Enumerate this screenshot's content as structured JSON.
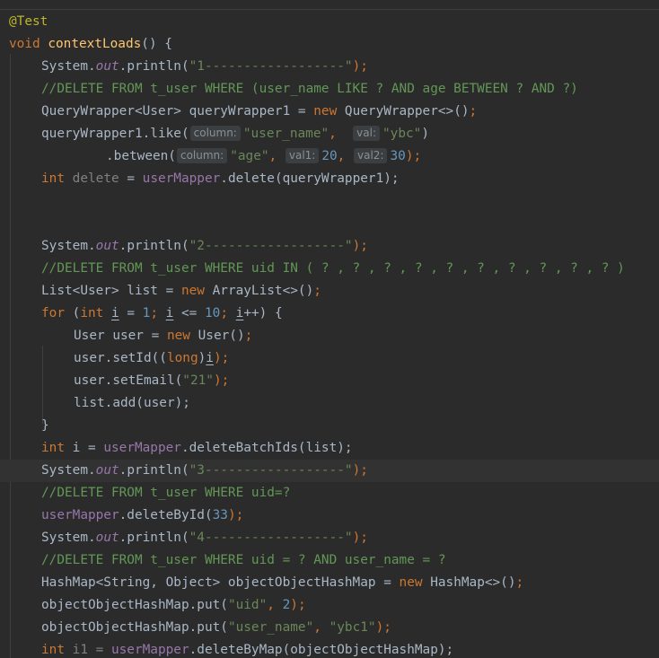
{
  "editor": {
    "annotation": "@Test",
    "method_decl": {
      "kw": "void",
      "name": "contextLoads",
      "rest": "() {"
    },
    "block1": {
      "print_prefix": "System.",
      "out": "out",
      "print_call": ".println(",
      "print_str": "\"1------------------\"",
      "print_end": ");",
      "comment": "//DELETE FROM t_user WHERE (user_name LIKE ? AND age BETWEEN ? AND ?)",
      "qw_type": "QueryWrapper<User> queryWrapper1 = ",
      "new_kw": "new",
      "qw_ctor": " QueryWrapper<>()",
      "semi": ";",
      "like_call": "queryWrapper1.like(",
      "hint_column": "column:",
      "like_arg1": "\"user_name\"",
      "comma": ",",
      "hint_val": "val:",
      "like_arg2": "\"ybc\"",
      "close_paren": ")",
      "between_call": ".between(",
      "between_arg1": "\"age\"",
      "hint_val1": "val1:",
      "between_arg2": "20",
      "hint_val2": "val2:",
      "between_arg3": "30",
      "close_semi": ");",
      "int_kw": "int",
      "delete_var": "delete",
      "assign": " = ",
      "mapper": "userMapper",
      "delete_call": ".delete(queryWrapper1);"
    },
    "block2": {
      "print_str": "\"2------------------\"",
      "comment": "//DELETE FROM t_user WHERE uid IN ( ? , ? , ? , ? , ? , ? , ? , ? , ? , ? )",
      "list_decl": "List<User> list = ",
      "list_ctor": " ArrayList<>()",
      "for_kw": "for",
      "for_open": " (",
      "i_var": "i",
      "eq": " = ",
      "one": "1",
      "semi_sp": "; ",
      "le": " <= ",
      "ten": "10",
      "inc": "++) {",
      "user_decl": "User user = ",
      "user_ctor": " User()",
      "setid_a": "user.setId((",
      "long_kw": "long",
      "setid_b": ")",
      "setid_c": ");",
      "setemail": "user.setEmail(",
      "email_str": "\"21\"",
      "list_add": "list.add(user);",
      "close_brace": "}",
      "batch_var": " i = ",
      "batch_call": ".deleteBatchIds(list);"
    },
    "block3": {
      "print_str": "\"3------------------\"",
      "comment": "//DELETE FROM t_user WHERE uid=?",
      "byid_call": ".deleteById(",
      "byid_arg": "33"
    },
    "block4": {
      "print_str": "\"4------------------\"",
      "comment": "//DELETE FROM t_user WHERE uid = ? AND user_name = ?",
      "map_type": "HashMap<String, Object> objectObjectHashMap = ",
      "map_ctor": " HashMap<>()",
      "put_call": "objectObjectHashMap.put(",
      "put1_key": "\"uid\"",
      "put1_val": "2",
      "put2_key": "\"user_name\"",
      "put2_val": "\"ybc1\"",
      "i1_var": " i1 = ",
      "bymap_call": ".deleteByMap(objectObjectHashMap);"
    }
  }
}
